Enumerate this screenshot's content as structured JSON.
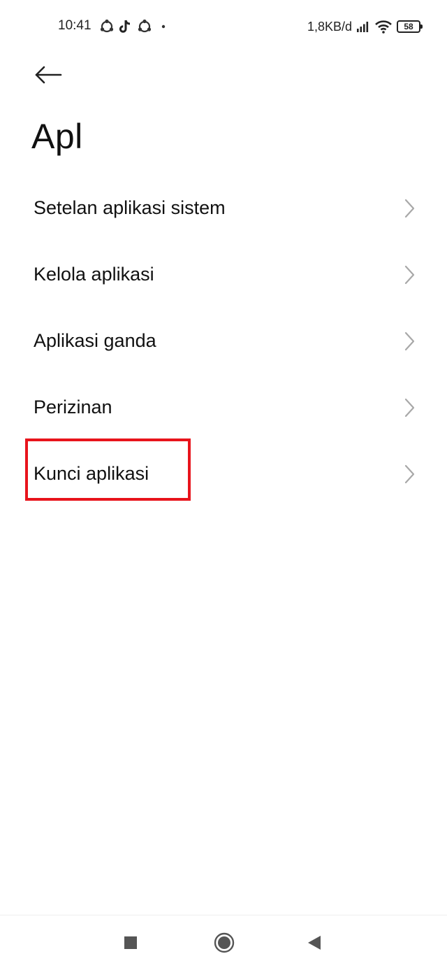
{
  "status_bar": {
    "time": "10:41",
    "left_icons": [
      "sync-icon",
      "tiktok-icon",
      "sync-icon",
      "dot-icon"
    ],
    "net_speed": "1,8KB/d",
    "battery_level": "58"
  },
  "header": {
    "back_icon": "arrow-left-icon",
    "title": "Apl"
  },
  "menu": {
    "items": [
      {
        "label": "Setelan aplikasi sistem"
      },
      {
        "label": "Kelola aplikasi"
      },
      {
        "label": "Aplikasi ganda"
      },
      {
        "label": "Perizinan"
      },
      {
        "label": "Kunci aplikasi"
      }
    ]
  },
  "highlight": {
    "target": "Kunci aplikasi",
    "color": "#e8141c"
  },
  "nav_bar": {
    "buttons": [
      "recents-icon",
      "home-icon",
      "back-triangle-icon"
    ]
  }
}
